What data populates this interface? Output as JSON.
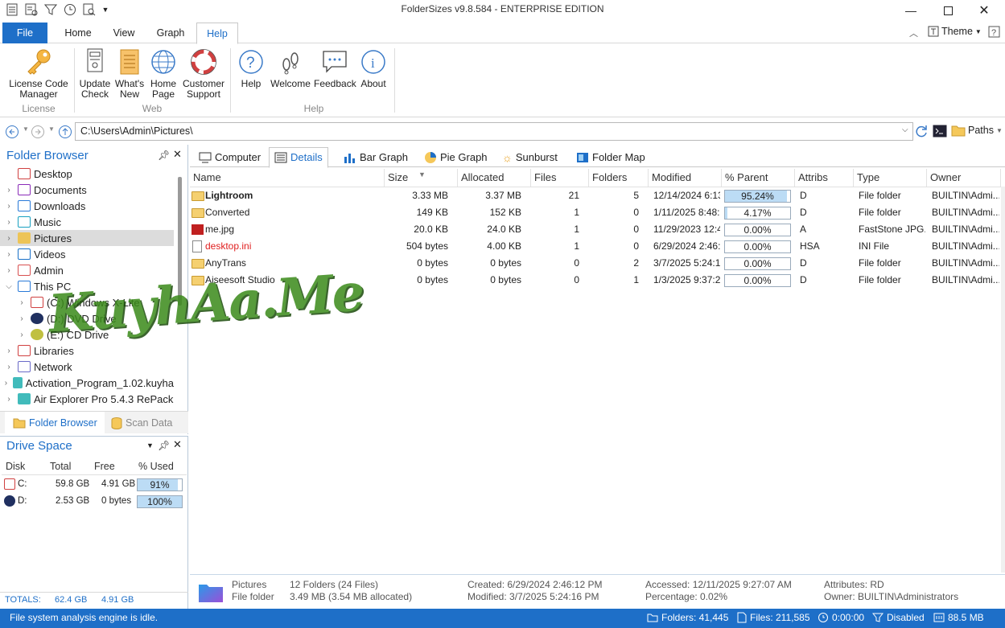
{
  "window": {
    "title": "FolderSizes v9.8.584 - ENTERPRISE EDITION"
  },
  "ribbon_tabs": [
    "File",
    "Home",
    "View",
    "Graph",
    "Help"
  ],
  "ribbon_right": {
    "theme_label": "Theme"
  },
  "ribbon": {
    "license": {
      "btn": "License Code Manager",
      "line1": "License Code",
      "line2": "Manager",
      "group": "License"
    },
    "web": {
      "group": "Web",
      "update": {
        "line1": "Update",
        "line2": "Check"
      },
      "whatsnew": {
        "line1": "What's",
        "line2": "New"
      },
      "homepage": {
        "line1": "Home",
        "line2": "Page"
      },
      "support": {
        "line1": "Customer",
        "line2": "Support"
      }
    },
    "help": {
      "group": "Help",
      "help": "Help",
      "welcome": "Welcome",
      "feedback": "Feedback",
      "about": "About"
    }
  },
  "address": {
    "path": "C:\\Users\\Admin\\Pictures\\",
    "paths_label": "Paths"
  },
  "folder_browser": {
    "title": "Folder Browser",
    "items": [
      {
        "label": "Desktop",
        "icon": "desktop-icon",
        "color": "#d04040"
      },
      {
        "label": "Documents",
        "icon": "documents-icon",
        "color": "#8a2bb8"
      },
      {
        "label": "Downloads",
        "icon": "downloads-icon",
        "color": "#2a7ad8"
      },
      {
        "label": "Music",
        "icon": "music-icon",
        "color": "#18a0c0"
      },
      {
        "label": "Pictures",
        "icon": "pictures-icon",
        "color": "#f0c040"
      },
      {
        "label": "Videos",
        "icon": "videos-icon",
        "color": "#1870c8"
      },
      {
        "label": "Admin",
        "icon": "user-icon",
        "color": "#d85050"
      },
      {
        "label": "This PC",
        "icon": "pc-icon",
        "color": "#2a7ad8"
      },
      {
        "label": "(C:) Windows X-Lite",
        "icon": "drive-icon",
        "color": "#d04040"
      },
      {
        "label": "(D:) DVD Drive",
        "icon": "dvd-icon",
        "color": "#203060"
      },
      {
        "label": "(E:) CD Drive",
        "icon": "cd-icon",
        "color": "#c0c040"
      },
      {
        "label": "Libraries",
        "icon": "libraries-icon",
        "color": "#d04040"
      },
      {
        "label": "Network",
        "icon": "network-icon",
        "color": "#6a6ac8"
      },
      {
        "label": "Activation_Program_1.02.kuyhа",
        "icon": "folder-icon",
        "color": "#20b0b0"
      },
      {
        "label": "Air Explorer Pro 5.4.3 RePack",
        "icon": "folder-icon",
        "color": "#20b0b0"
      }
    ],
    "tab_browser": "Folder Browser",
    "tab_scan": "Scan Data"
  },
  "drive_space": {
    "title": "Drive Space",
    "headers": [
      "Disk",
      "Total",
      "Free",
      "% Used"
    ],
    "rows": [
      {
        "disk": "C:",
        "total": "59.8 GB",
        "free": "4.91 GB",
        "used": "91%",
        "pct": 0.91
      },
      {
        "disk": "D:",
        "total": "2.53 GB",
        "free": "0 bytes",
        "used": "100%",
        "pct": 1.0
      }
    ],
    "totals": {
      "label": "TOTALS:",
      "total": "62.4 GB",
      "free": "4.91 GB"
    }
  },
  "view_tabs": [
    "Computer",
    "Details",
    "Bar Graph",
    "Pie Graph",
    "Sunburst",
    "Folder Map"
  ],
  "columns": [
    "Name",
    "Size",
    "Allocated",
    "Files",
    "Folders",
    "Modified",
    "% Parent",
    "Attribs",
    "Type",
    "Owner"
  ],
  "rows": [
    {
      "name": "Lightroom",
      "size": "3.33 MB",
      "alloc": "3.37 MB",
      "files": "21",
      "folders": "5",
      "modified": "12/14/2024 6:13...",
      "parent": "95.24%",
      "pct": 0.9524,
      "attribs": "D",
      "type": "File folder",
      "owner": "BUILTIN\\Admi...",
      "bold": true
    },
    {
      "name": "Converted",
      "size": "149 KB",
      "alloc": "152 KB",
      "files": "1",
      "folders": "0",
      "modified": "1/11/2025 8:48:...",
      "parent": "4.17%",
      "pct": 0.0417,
      "attribs": "D",
      "type": "File folder",
      "owner": "BUILTIN\\Admi..."
    },
    {
      "name": "me.jpg",
      "size": "20.0 KB",
      "alloc": "24.0 KB",
      "files": "1",
      "folders": "0",
      "modified": "11/29/2023 12:4...",
      "parent": "0.00%",
      "pct": 0,
      "attribs": "A",
      "type": "FastStone JPG...",
      "owner": "BUILTIN\\Admi..."
    },
    {
      "name": "desktop.ini",
      "size": "504 bytes",
      "alloc": "4.00 KB",
      "files": "1",
      "folders": "0",
      "modified": "6/29/2024 2:46:...",
      "parent": "0.00%",
      "pct": 0,
      "attribs": "HSA",
      "type": "INI File",
      "owner": "BUILTIN\\Admi...",
      "red": true
    },
    {
      "name": "AnyTrans",
      "size": "0 bytes",
      "alloc": "0 bytes",
      "files": "0",
      "folders": "2",
      "modified": "3/7/2025 5:24:1...",
      "parent": "0.00%",
      "pct": 0,
      "attribs": "D",
      "type": "File folder",
      "owner": "BUILTIN\\Admi..."
    },
    {
      "name": "Aiseesoft Studio",
      "size": "0 bytes",
      "alloc": "0 bytes",
      "files": "0",
      "folders": "1",
      "modified": "1/3/2025 9:37:2...",
      "parent": "0.00%",
      "pct": 0,
      "attribs": "D",
      "type": "File folder",
      "owner": "BUILTIN\\Admi..."
    }
  ],
  "details_footer": {
    "name": "Pictures",
    "kind": "File folder",
    "folders": "12 Folders (24 Files)",
    "size": "3.49 MB (3.54 MB allocated)",
    "created": "Created: 6/29/2024 2:46:12 PM",
    "modified": "Modified: 3/7/2025 5:24:16 PM",
    "accessed": "Accessed: 12/11/2025 9:27:07 AM",
    "percentage": "Percentage: 0.02%",
    "attributes": "Attributes: RD",
    "owner": "Owner: BUILTIN\\Administrators"
  },
  "status": {
    "message": "File system analysis engine is idle.",
    "folders": "Folders: 41,445",
    "files": "Files: 211,585",
    "time": "0:00:00",
    "disabled": "Disabled",
    "memory": "88.5 MB"
  },
  "watermark": "KuyhAa.Me",
  "colors": {
    "accent": "#1e6fc8",
    "bar_fill": "#bcdcf5",
    "red_text": "#e02020"
  }
}
